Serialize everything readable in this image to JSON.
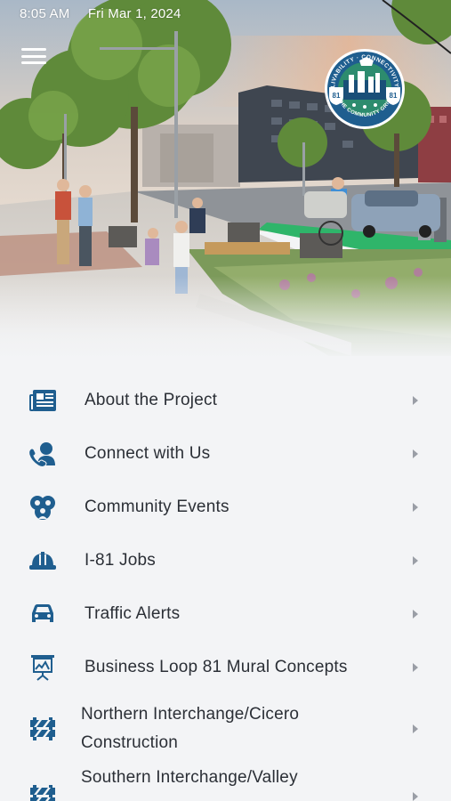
{
  "status_bar": {
    "time": "8:05 AM",
    "date": "Fri Mar 1, 2024"
  },
  "header": {
    "menu_icon": "hamburger-menu-icon"
  },
  "logo": {
    "text_top": "LIVABILITY · CONNECTIVITY",
    "text_bottom": "THE COMMUNITY GRID",
    "shield_left": "81",
    "shield_right": "81"
  },
  "colors": {
    "icon_blue": "#1f5e8f",
    "text": "#2b2f36",
    "background": "#f3f4f6",
    "chevron": "#9a9ea6"
  },
  "menu": {
    "items": [
      {
        "label": "About the Project",
        "icon": "newspaper-icon"
      },
      {
        "label": "Connect with Us",
        "icon": "phone-contact-icon"
      },
      {
        "label": "Community Events",
        "icon": "people-group-icon"
      },
      {
        "label": "I-81 Jobs",
        "icon": "hard-hat-icon"
      },
      {
        "label": "Traffic Alerts",
        "icon": "car-icon"
      },
      {
        "label": "Business Loop 81 Mural Concepts",
        "icon": "presentation-board-icon"
      },
      {
        "label": "Northern Interchange/Cicero\nConstruction",
        "icon": "road-barrier-icon"
      },
      {
        "label": "Southern Interchange/Valley",
        "icon": "road-barrier-icon"
      }
    ]
  }
}
